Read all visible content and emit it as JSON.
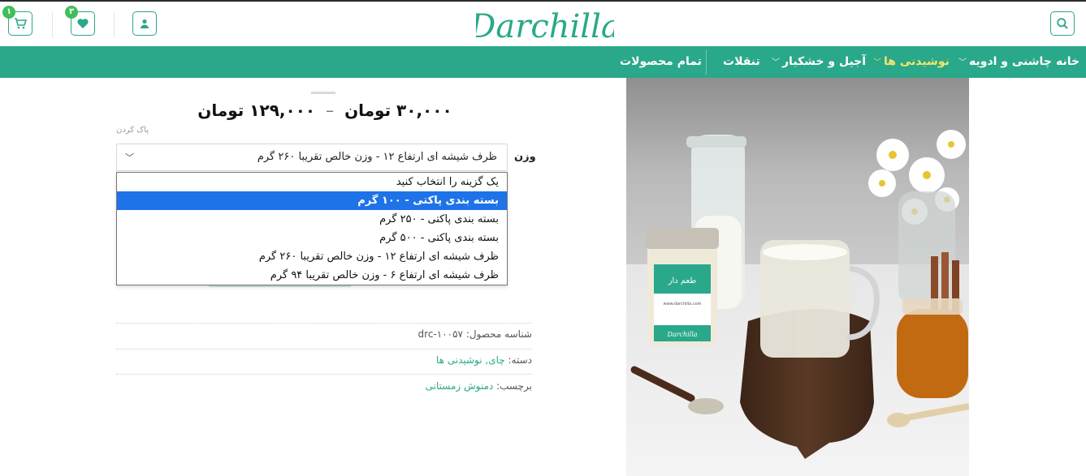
{
  "header": {
    "logo_text": "Darchilla",
    "cart_badge": "۱",
    "wishlist_badge": "۳"
  },
  "icons": {
    "cart": "cart-icon",
    "wishlist": "heart-icon",
    "account": "user-icon",
    "search": "search-icon"
  },
  "nav": {
    "items": [
      {
        "label": "خانه",
        "has_dropdown": false
      },
      {
        "label": "چاشنی و ادویه",
        "has_dropdown": true
      },
      {
        "label": "نوشیدنی ها",
        "has_dropdown": true,
        "active": true
      },
      {
        "label": "آجیل و خشکبار",
        "has_dropdown": true
      },
      {
        "label": "تنقلات",
        "has_dropdown": false
      },
      {
        "label": "تمام محصولات",
        "has_dropdown": false
      }
    ]
  },
  "product": {
    "price_low": "۳۰,۰۰۰",
    "price_high": "۱۲۹,۰۰۰",
    "currency": "تومان",
    "price_separator": "–",
    "reset_label": "پاک کردن",
    "weight_label": "وزن",
    "selected_value": "ظرف شیشه ای ارتفاع ۱۲ - وزن خالص تقریبا ۲۶۰ گرم",
    "options": [
      "یک گزینه را انتخاب کنید",
      "بسته بندی پاکتی - ۱۰۰ گرم",
      "بسته بندی پاکتی - ۲۵۰ گرم",
      "بسته بندی پاکتی - ۵۰۰ گرم",
      "ظرف شیشه ای ارتفاع ۱۲ - وزن خالص تقریبا ۲۶۰ گرم",
      "ظرف شیشه ای ارتفاع ۶ - وزن خالص تقریبا ۹۴ گرم"
    ],
    "highlighted_option_index": 1,
    "sku_label": "شناسه محصول:",
    "sku_value": "drc-۱۰۰۵۷",
    "category_label": "دسته:",
    "category_value": "چای, نوشیدنی ها",
    "tag_label": "برچسب:",
    "tag_value": "دمنوش زمستانی"
  },
  "image": {
    "jar_brand": "Darchilla",
    "jar_label_text": "طعم دار",
    "jar_website": "www.darchilla.com"
  },
  "colors": {
    "brand_green": "#2aa88a",
    "nav_active": "#f5e56b",
    "badge_green": "#3fbf5a",
    "dropdown_highlight": "#1e73e8"
  }
}
